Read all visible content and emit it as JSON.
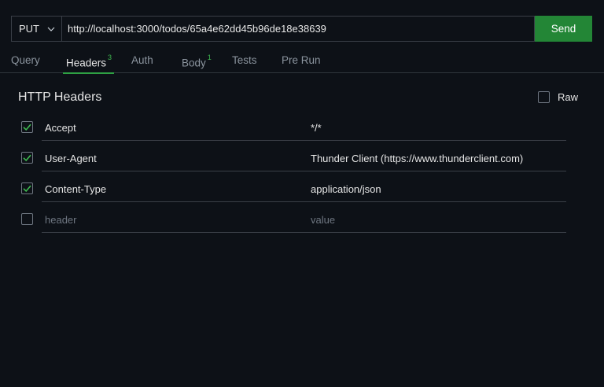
{
  "request": {
    "method": "PUT",
    "url": "http://localhost:3000/todos/65a4e62dd45b96de18e38639",
    "send_label": "Send"
  },
  "tabs": [
    {
      "label": "Query",
      "count": ""
    },
    {
      "label": "Headers",
      "count": "3"
    },
    {
      "label": "Auth",
      "count": ""
    },
    {
      "label": "Body",
      "count": "1"
    },
    {
      "label": "Tests",
      "count": ""
    },
    {
      "label": "Pre Run",
      "count": ""
    }
  ],
  "active_tab": "Headers",
  "headers_section": {
    "title": "HTTP Headers",
    "raw_label": "Raw",
    "rows": [
      {
        "checked": true,
        "key": "Accept",
        "value": "*/*"
      },
      {
        "checked": true,
        "key": "User-Agent",
        "value": "Thunder Client (https://www.thunderclient.com)"
      },
      {
        "checked": true,
        "key": "Content-Type",
        "value": "application/json"
      }
    ],
    "new_row": {
      "checked": false,
      "key_placeholder": "header",
      "value_placeholder": "value"
    }
  },
  "colors": {
    "background": "#0d1117",
    "accent_green": "#238636",
    "check_green": "#3fb950",
    "muted_text": "#8b949e",
    "border": "#3a3f47"
  }
}
